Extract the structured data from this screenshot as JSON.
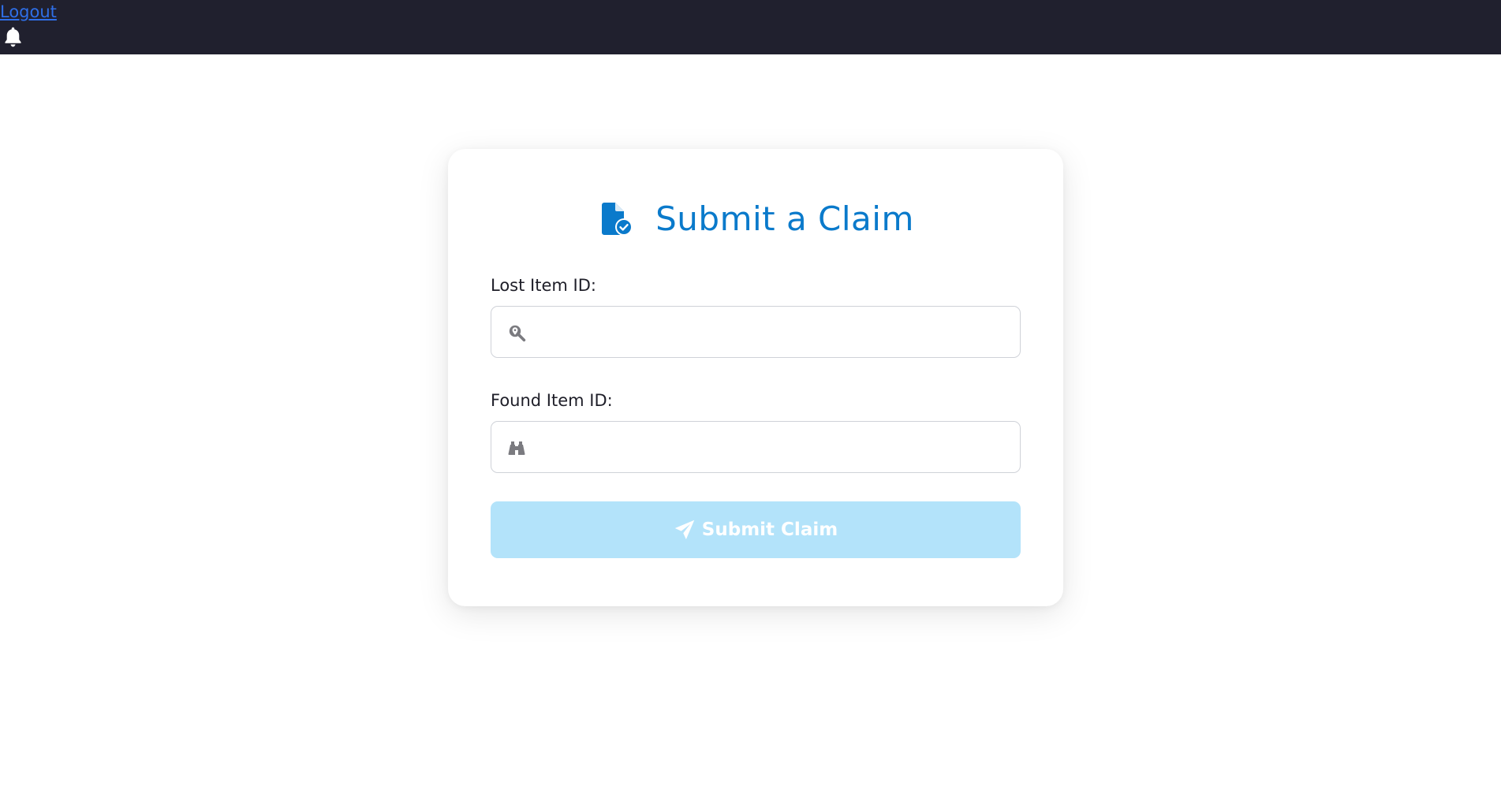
{
  "header": {
    "logout_label": "Logout",
    "bell_icon": "bell-icon"
  },
  "form": {
    "title": "Submit a Claim",
    "title_icon": "file-check-icon",
    "lost_item": {
      "label": "Lost Item ID:",
      "value": "",
      "placeholder": "",
      "icon": "search-location-icon"
    },
    "found_item": {
      "label": "Found Item ID:",
      "value": "",
      "placeholder": "",
      "icon": "binoculars-icon"
    },
    "submit": {
      "label": "Submit Claim",
      "icon": "paper-plane-icon"
    }
  },
  "colors": {
    "topbar": "#20202e",
    "accent": "#0a7acb",
    "link": "#2f6fe8",
    "button_disabled": "#b3e3fa"
  }
}
